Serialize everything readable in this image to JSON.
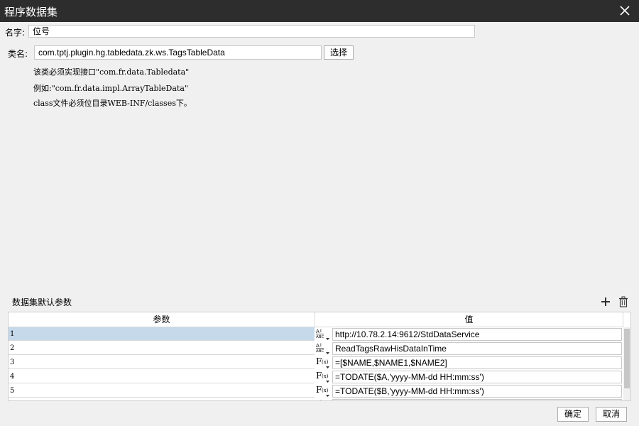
{
  "window": {
    "title": "程序数据集"
  },
  "form": {
    "name_label": "名字:",
    "name_value": "位号",
    "class_label": "类名:",
    "class_value": "com.tptj.plugin.hg.tabledata.zk.ws.TagsTableData",
    "select_button": "选择"
  },
  "notes": [
    "该类必须实现接口\"com.fr.data.Tabledata\"",
    "例如:\"com.fr.data.impl.ArrayTableData\"",
    "class文件必须位目录WEB-INF/classes下。"
  ],
  "params": {
    "section_title": "数据集默认参数",
    "columns": [
      "参数",
      "值"
    ],
    "rows": [
      {
        "param": "1",
        "type": "text",
        "value": "http://10.78.2.14:9612/StdDataService"
      },
      {
        "param": "2",
        "type": "text",
        "value": "ReadTagsRawHisDataInTime"
      },
      {
        "param": "3",
        "type": "formula",
        "value": "=[$NAME,$NAME1,$NAME2]"
      },
      {
        "param": "4",
        "type": "formula",
        "value": "=TODATE($A,'yyyy-MM-dd HH:mm:ss')"
      },
      {
        "param": "5",
        "type": "formula",
        "value": "=TODATE($B,'yyyy-MM-dd HH:mm:ss')"
      },
      {
        "param": "",
        "type": "text",
        "value": ""
      }
    ]
  },
  "footer": {
    "ok": "确定",
    "cancel": "取消"
  },
  "icons": {
    "close": "close-icon",
    "add": "plus-icon",
    "delete": "trash-icon",
    "text_type": "text-type-icon",
    "formula_type": "formula-icon"
  }
}
